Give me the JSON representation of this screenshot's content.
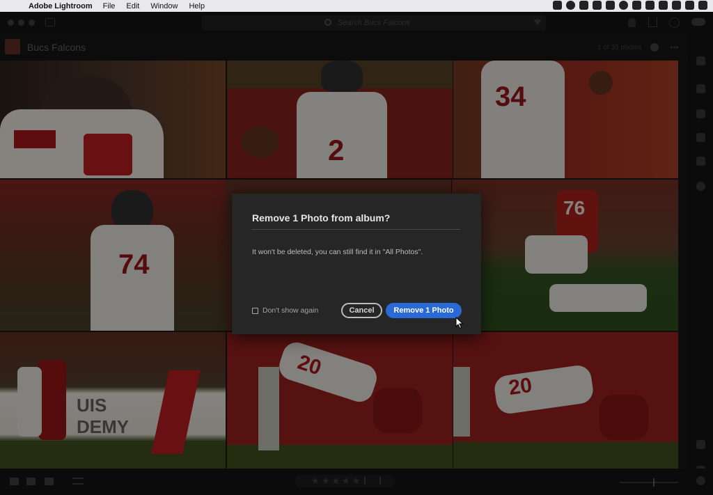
{
  "menubar": {
    "app_name": "Adobe Lightroom",
    "menus": [
      "File",
      "Edit",
      "Window",
      "Help"
    ]
  },
  "toolbar": {
    "search_placeholder": "Search Bucs Falcons"
  },
  "album": {
    "title": "Bucs Falcons",
    "photo_count": "1 of 30 photos"
  },
  "bottom_bar": {
    "rating_stars": "★★★★★"
  },
  "dialog": {
    "title": "Remove 1 Photo from album?",
    "message": "It won't be deleted, you can still find it in \"All Photos\".",
    "checkbox_label": "Don't show again",
    "cancel_label": "Cancel",
    "confirm_label": "Remove 1 Photo"
  },
  "colors": {
    "falcons_red": "#c8202a",
    "bucs_red": "#b8261d",
    "accent_blue": "#2a6ad6",
    "dialog_bg": "#262626"
  },
  "icons": {
    "search": "search-icon",
    "filter": "filter-icon",
    "share": "share-icon",
    "cloud": "cloud-icon"
  }
}
